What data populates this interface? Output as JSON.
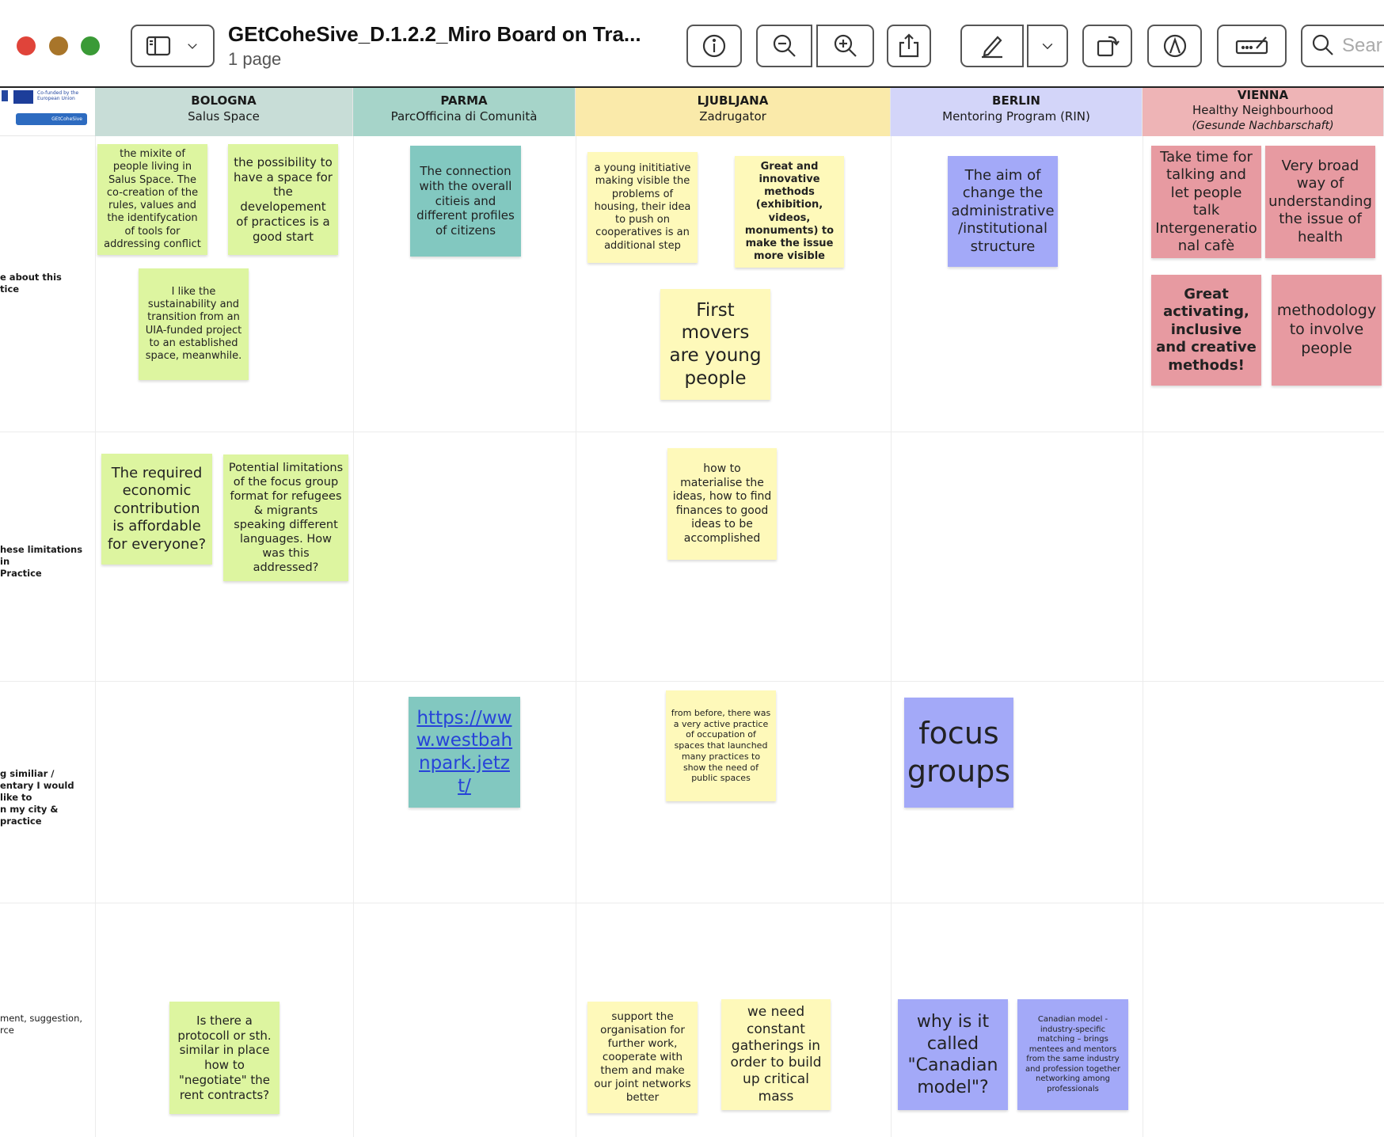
{
  "window": {
    "title": "GEtCoheSive_D.1.2.2_Miro Board on Tra...",
    "pages": "1 page",
    "search_placeholder": "Sear"
  },
  "logos": {
    "eu_text": "Co-funded by the European Union",
    "project": "GEtCoheSive"
  },
  "columns": [
    {
      "city": "BOLOGNA",
      "practice": "Salus Space",
      "color": "#c8ddd7"
    },
    {
      "city": "PARMA",
      "practice": "ParcOfficina di Comunità",
      "color": "#a6d4c9"
    },
    {
      "city": "LJUBLJANA",
      "practice": "Zadrugator",
      "color": "#faeaaa"
    },
    {
      "city": "BERLIN",
      "practice": "Mentoring Program (RIN)",
      "color": "#d3d5f9"
    },
    {
      "city": "VIENNA",
      "practice": "Healthy Neighbourhood",
      "practice_sub": "(Gesunde Nachbarschaft)",
      "color": "#eeb4b6"
    }
  ],
  "rows": [
    "e about this\ntice",
    "hese limitations in\nPractice",
    "g similiar /\nentary I would like to\nn my city & practice",
    "ment, suggestion,\nrce"
  ],
  "notes": {
    "n1": "the mixite of people living in Salus Space. The co-creation of the rules, values and the identifycation of tools for addressing conflict",
    "n2": "the possibility to have a space for the developement of practices is a good start",
    "n3": "I like the sustainability and transition from an UIA-funded project to an established space, meanwhile.",
    "n4": "The connection with the overall citieis and different profiles of citizens",
    "n5": "a young inititiative making visible the problems of housing, their idea to push on cooperatives is an additional step",
    "n6": "Great and innovative methods (exhibition, videos, monuments) to make the issue more visible",
    "n7": "First movers are young people",
    "n8": "The aim of change the administrative /institutional structure",
    "n9": "Take time for talking and let people talk Intergeneratio nal cafè",
    "n10": "Very broad way of understanding the issue of health",
    "n11": "Great activating, inclusive and creative methods!",
    "n12": "methodology to involve people",
    "n13": "The required economic contribution is affordable for everyone?",
    "n14": "Potential limitations of the focus group format for refugees & migrants speaking different languages. How was this addressed?",
    "n15": "how to materialise the ideas, how to find finances to good ideas to be accomplished",
    "n16": "https://www.westbahnpark.jetzt/",
    "n17": "from before, there was a very active practice of occupation of spaces that launched many practices to show the need of public spaces",
    "n18": "focus groups",
    "n19": "Is there a protocoll or sth. similar in place how to \"negotiate\" the rent contracts?",
    "n20": "support the organisation for further work, cooperate with them and make our joint networks better",
    "n21": "we need constant gatherings in order to build up critical mass",
    "n22": "why is it called \"Canadian model\"?",
    "n23": "Canadian model - industry-specific matching – brings mentees and mentors from the same industry and profession together networking among professionals"
  },
  "note_colors": {
    "green": "#ddf5a0",
    "teal": "#82c8c0",
    "yellow": "#fef9ba",
    "purple": "#a3a9f8",
    "pink": "#e79aa1"
  }
}
